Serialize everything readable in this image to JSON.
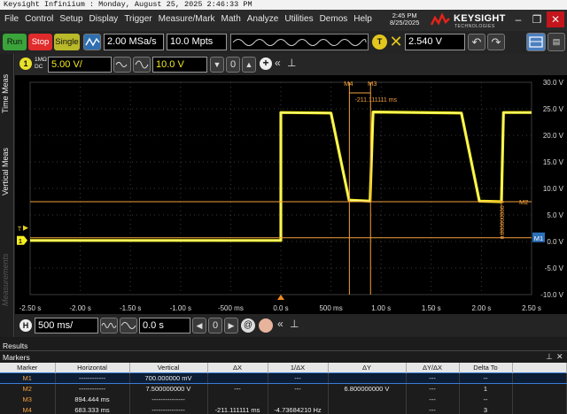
{
  "window": {
    "title": "Keysight Infiniium : Monday, August 25, 2025 2:46:33 PM",
    "clock_time": "2:45 PM",
    "clock_date": "8/25/2025",
    "brand": "KEYSIGHT",
    "brand_sub": "TECHNOLOGIES"
  },
  "menu": [
    "File",
    "Control",
    "Setup",
    "Display",
    "Trigger",
    "Measure/Mark",
    "Math",
    "Analyze",
    "Utilities",
    "Demos",
    "Help"
  ],
  "toolbar": {
    "run": "Run",
    "stop": "Stop",
    "single": "Single",
    "sample_rate": "2.00 MSa/s",
    "memory_depth": "10.0 Mpts",
    "trigger_badge": "T",
    "trigger_level": "2.540 V"
  },
  "channel": {
    "number": "1",
    "coupling_top": "1MΩ",
    "coupling_bottom": "DC",
    "scale": "5.00 V/",
    "offset": "10.0 V"
  },
  "side_tabs": [
    "Time Meas",
    "Vertical Meas",
    "Measurements"
  ],
  "plot": {
    "x_ticks": [
      "-2.50 s",
      "-2.00 s",
      "-1.50 s",
      "-1.00 s",
      "-500 ms",
      "0.0 s",
      "500 ms",
      "1.00 s",
      "1.50 s",
      "2.00 s",
      "2.50 s"
    ],
    "y_ticks": [
      "30.0 V",
      "25.0 V",
      "20.0 V",
      "15.0 V",
      "10.0 V",
      "5.0 V",
      "0.0 V",
      "-5.0 V",
      "-10.0 V"
    ],
    "ground_label": "1",
    "trigger_marker": "T",
    "marker_labels": {
      "m1": "M1",
      "m2": "M2",
      "m3": "M3",
      "m4": "M4"
    },
    "delta_x_readout": "-211.111111 ms",
    "delta_y_readout": "6.800000000 V",
    "waveform_color": "#f5ef1e",
    "marker_color": "#f4a03c"
  },
  "timebase": {
    "badge": "H",
    "scale": "500 ms/",
    "position": "0.0 s"
  },
  "results": {
    "title": "Results",
    "section": "Markers",
    "columns": [
      "Marker",
      "Horizontal",
      "Vertical",
      "ΔX",
      "1/ΔX",
      "ΔY",
      "ΔY/ΔX",
      "Delta To"
    ],
    "rows": [
      [
        "M1",
        "------------",
        "700.000000 mV",
        "",
        "---",
        "",
        "---",
        "--"
      ],
      [
        "M2",
        "------------",
        "7.500000000 V",
        "---",
        "---",
        "6.800000000 V",
        "---",
        "1"
      ],
      [
        "M3",
        "894.444 ms",
        "---------------",
        "",
        "",
        "",
        "---",
        "--"
      ],
      [
        "M4",
        "683.333 ms",
        "---------------",
        "-211.111111 ms",
        "-4.73684210 Hz",
        "",
        "---",
        "3"
      ]
    ]
  }
}
